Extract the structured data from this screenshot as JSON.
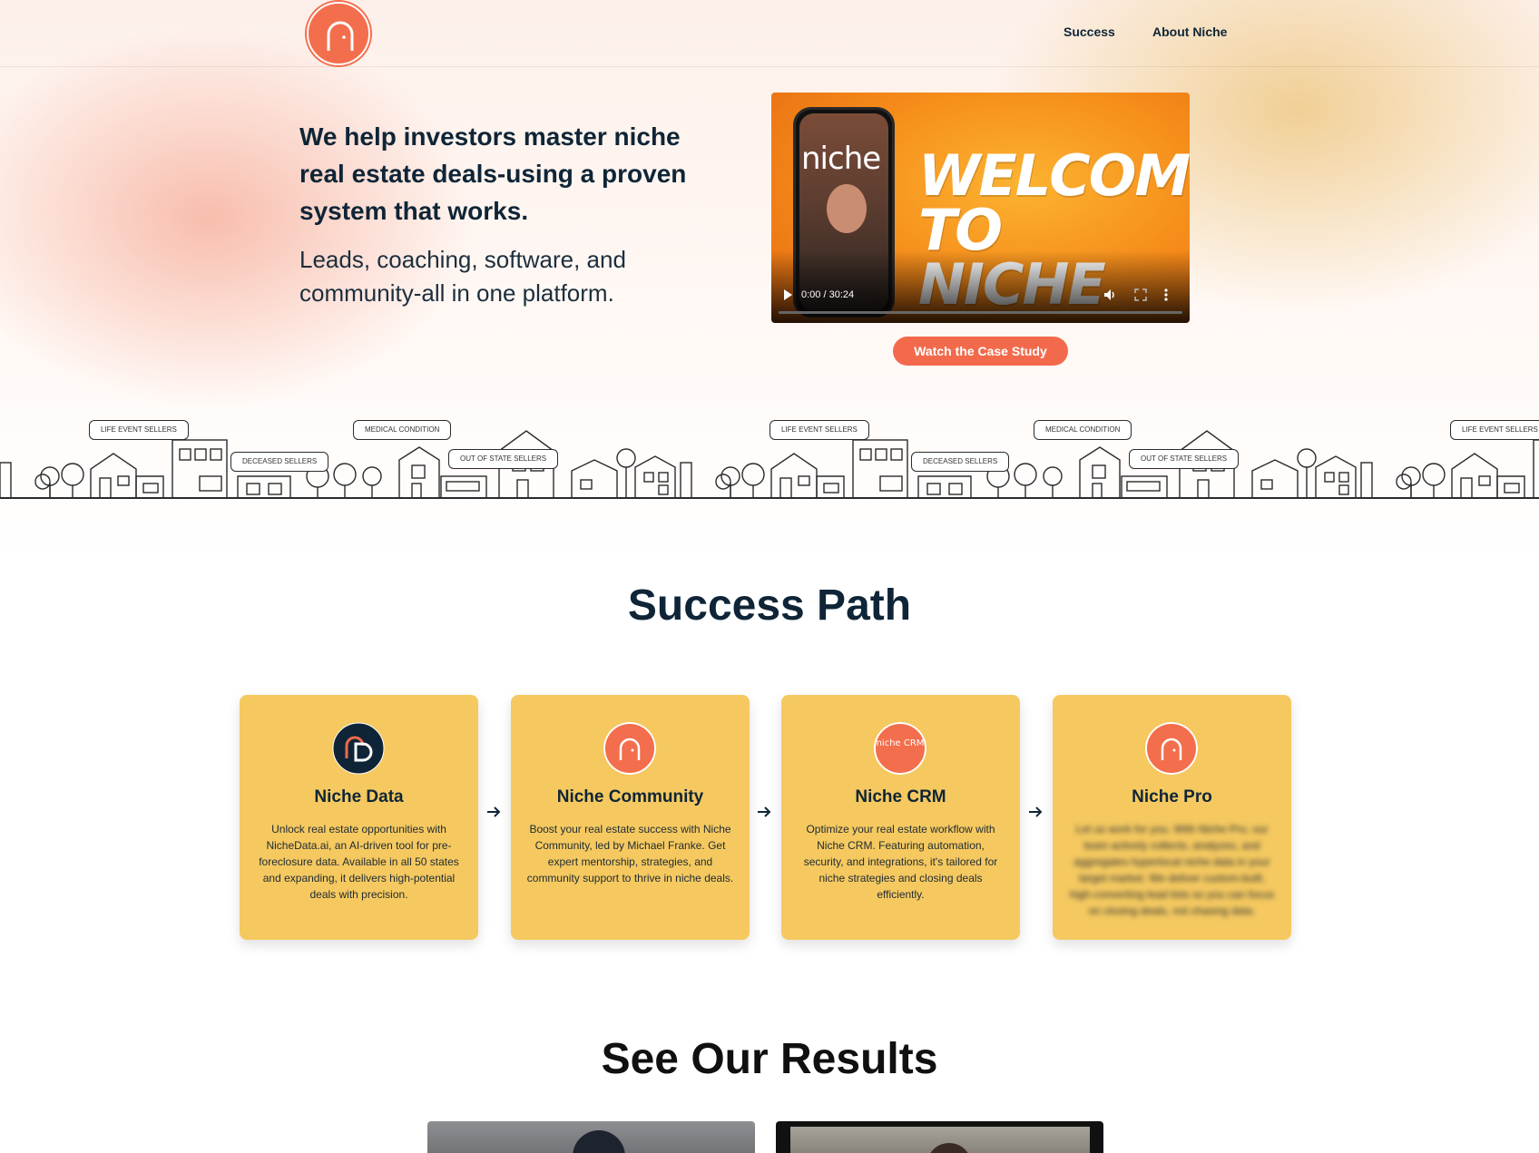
{
  "header": {
    "nav": [
      "Success",
      "About Niche"
    ]
  },
  "hero": {
    "title": "We help investors master niche real estate deals-using a proven system that works.",
    "subtitle": "Leads, coaching, software, and community-all in one platform.",
    "video": {
      "headline": "WELCOME TO NICHE",
      "phone_logo": "niche",
      "time": "0:00 / 30:24"
    },
    "cta_label": "Watch the Case Study"
  },
  "town": {
    "labels": [
      "LIFE EVENT SELLERS",
      "MEDICAL CONDITION",
      "DECEASED SELLERS",
      "OUT OF STATE SELLERS"
    ]
  },
  "success": {
    "title": "Success Path",
    "cards": [
      {
        "title": "Niche Data",
        "icon": "niche-data-logo",
        "description": "Unlock real estate opportunities with NicheData.ai, an AI-driven tool for pre-foreclosure data. Available in all 50 states and expanding, it delivers high-potential deals with precision."
      },
      {
        "title": "Niche Community",
        "icon": "niche-logo",
        "description": "Boost your real estate success with Niche Community, led by Michael Franke. Get expert mentorship, strategies, and community support to thrive in niche deals."
      },
      {
        "title": "Niche CRM",
        "icon": "niche-crm-logo",
        "icon_text": "niche CRM",
        "description": "Optimize your real estate workflow with Niche CRM. Featuring automation, security, and integrations, it's tailored for niche strategies and closing deals efficiently."
      },
      {
        "title": "Niche Pro",
        "icon": "niche-logo",
        "description": "Let us work for you. With Niche Pro, our team actively collects, analyzes, and aggregates hyperlocal niche data in your target market. We deliver custom-built, high-converting lead lists so you can focus on closing deals, not chasing data."
      }
    ]
  },
  "results": {
    "title": "See Our Results"
  },
  "colors": {
    "accent": "#f26a4b",
    "card": "#f5c960",
    "ink": "#0f2537"
  }
}
